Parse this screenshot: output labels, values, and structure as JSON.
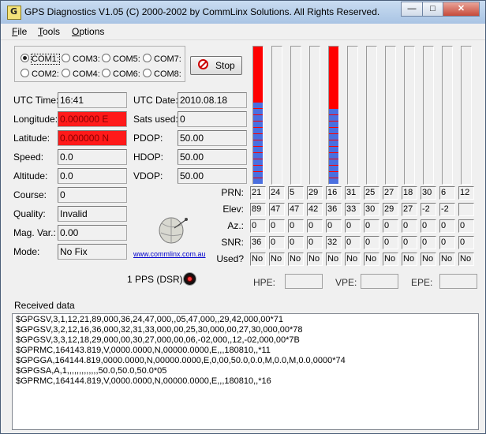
{
  "window": {
    "title": "GPS Diagnostics V1.05 (C) 2000-2002 by CommLinx Solutions. All Rights Reserved.",
    "controls": [
      "—",
      "□",
      "✕"
    ]
  },
  "menu": [
    "File",
    "Tools",
    "Options"
  ],
  "ports": [
    {
      "label": "COM1:",
      "selected": true
    },
    {
      "label": "COM3:",
      "selected": false
    },
    {
      "label": "COM5:",
      "selected": false
    },
    {
      "label": "COM7:",
      "selected": false
    },
    {
      "label": "COM2:",
      "selected": false
    },
    {
      "label": "COM4:",
      "selected": false
    },
    {
      "label": "COM6:",
      "selected": false
    },
    {
      "label": "COM8:",
      "selected": false
    }
  ],
  "stop_label": "Stop",
  "fields_left": [
    {
      "label": "UTC Time:",
      "value": "16:41"
    },
    {
      "label": "Longitude:",
      "value": "0.000000 E"
    },
    {
      "label": "Latitude:",
      "value": "0.000000 N"
    },
    {
      "label": "Speed:",
      "value": "0.0"
    },
    {
      "label": "Altitude:",
      "value": "0.0"
    },
    {
      "label": "Course:",
      "value": "0"
    },
    {
      "label": "Quality:",
      "value": "Invalid"
    },
    {
      "label": "Mag. Var.:",
      "value": "0.00"
    },
    {
      "label": "Mode:",
      "value": "No Fix"
    }
  ],
  "fields_mid": [
    {
      "label": "UTC Date:",
      "value": "2010.08.18"
    },
    {
      "label": "Sats used:",
      "value": "0"
    },
    {
      "label": "PDOP:",
      "value": "50.00"
    },
    {
      "label": "HDOP:",
      "value": "50.00"
    },
    {
      "label": "VDOP:",
      "value": "50.00"
    }
  ],
  "colors": {
    "invalid_field": "#ff1a1a",
    "bar_red": "#ff0000",
    "bar_blue": "#4a6fe0"
  },
  "satellites": {
    "row_labels": [
      "PRN:",
      "Elev:",
      "Az.:",
      "SNR:",
      "Used?"
    ],
    "prn": [
      "21",
      "24",
      "5",
      "29",
      "16",
      "31",
      "25",
      "27",
      "18",
      "30",
      "6",
      "12"
    ],
    "elev": [
      "89",
      "47",
      "47",
      "42",
      "36",
      "33",
      "30",
      "29",
      "27",
      "-2",
      "-2",
      ""
    ],
    "az": [
      "0",
      "0",
      "0",
      "0",
      "0",
      "0",
      "0",
      "0",
      "0",
      "0",
      "0",
      "0"
    ],
    "snr": [
      "36",
      "0",
      "0",
      "0",
      "32",
      "0",
      "0",
      "0",
      "0",
      "0",
      "0",
      "0"
    ],
    "used": [
      "No",
      "No",
      "No",
      "No",
      "No",
      "No",
      "No",
      "No",
      "No",
      "No",
      "No",
      "No"
    ],
    "bar_level": [
      1,
      0,
      0,
      0,
      1,
      0,
      0,
      0,
      0,
      0,
      0,
      0
    ],
    "bar_blue_level": [
      0.6,
      0,
      0,
      0,
      0.55,
      0,
      0,
      0,
      0,
      0,
      0,
      0
    ]
  },
  "logo_link": "www.commlinx.com.au",
  "pps_label": "1 PPS (DSR):",
  "error_labels": [
    "HPE:",
    "VPE:",
    "EPE:"
  ],
  "received_label": "Received data",
  "received_lines": [
    "$GPGSV,3,1,12,21,89,000,36,24,47,000,,05,47,000,,29,42,000,00*71",
    "$GPGSV,3,2,12,16,36,000,32,31,33,000,00,25,30,000,00,27,30,000,00*78",
    "$GPGSV,3,3,12,18,29,000,00,30,27,000,00,06,-02,000,,12,-02,000,00*7B",
    "$GPRMC,164143.819,V,0000.0000,N,00000.0000,E,,,180810,,*11",
    "$GPGGA,164144.819,0000.0000,N,00000.0000,E,0,00,50.0,0.0,M,0.0,M,0.0,0000*74",
    "$GPGSA,A,1,,,,,,,,,,,,,50.0,50.0,50.0*05",
    "$GPRMC,164144.819,V,0000.0000,N,00000.0000,E,,,180810,,*16"
  ]
}
